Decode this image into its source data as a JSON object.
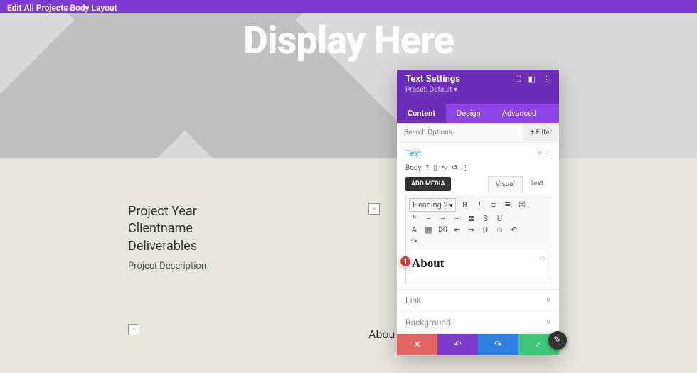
{
  "topBar": {
    "title": "Edit All Projects Body Layout"
  },
  "hero": {
    "title": "Display Here"
  },
  "leftBlock": {
    "line1": "Project Year",
    "line2": "Clientname",
    "line3": "Deliverables",
    "desc": "Project Description"
  },
  "aboutLabel": "Abou",
  "modal": {
    "title": "Text Settings",
    "preset": "Preset: Default ▾",
    "tabs": {
      "content": "Content",
      "design": "Design",
      "advanced": "Advanced"
    },
    "searchPlaceholder": "Search Options",
    "filter": "Filter",
    "textSection": "Text",
    "bodyLabel": "Body",
    "addMedia": "ADD MEDIA",
    "visualTab": "Visual",
    "textTab": "Text",
    "headingSel": "Heading 2",
    "editorContent": "About",
    "marker": "1",
    "linkSection": "Link",
    "bgSection": "Background"
  },
  "footer": {
    "cancel": "✕",
    "undo": "↶",
    "redo": "↷",
    "save": "✓"
  },
  "floatBtn": "✎"
}
